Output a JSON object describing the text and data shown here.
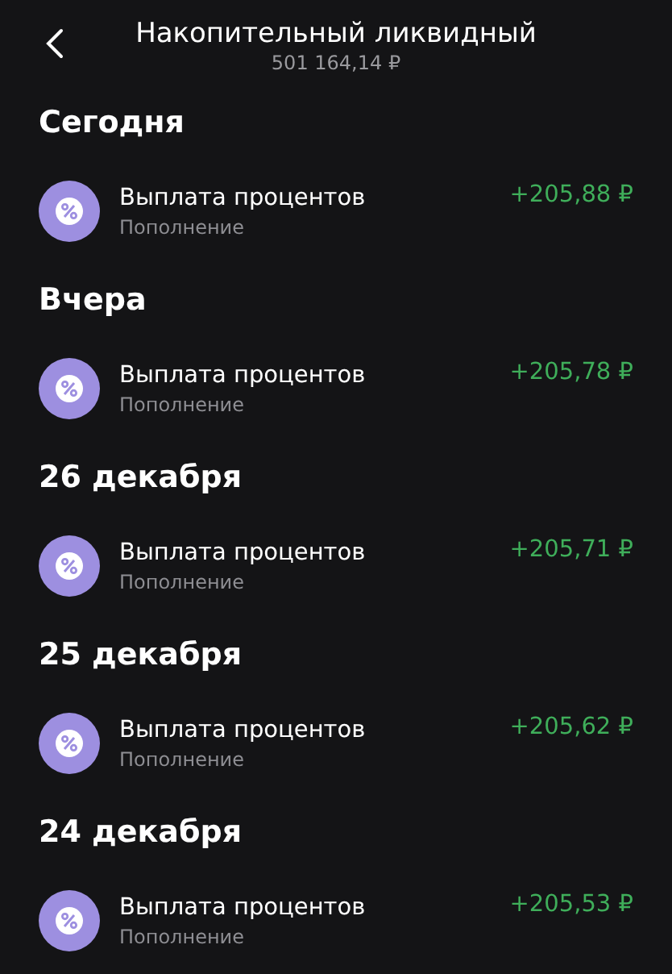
{
  "header": {
    "title": "Накопительный ликвидный",
    "balance": "501 164,14 ₽"
  },
  "days": [
    {
      "date": "Сегодня",
      "transactions": [
        {
          "title": "Выплата процентов",
          "subtitle": "Пополнение",
          "amount": "+205,88 ₽"
        }
      ]
    },
    {
      "date": "Вчера",
      "transactions": [
        {
          "title": "Выплата процентов",
          "subtitle": "Пополнение",
          "amount": "+205,78 ₽"
        }
      ]
    },
    {
      "date": "26 декабря",
      "transactions": [
        {
          "title": "Выплата процентов",
          "subtitle": "Пополнение",
          "amount": "+205,71 ₽"
        }
      ]
    },
    {
      "date": "25 декабря",
      "transactions": [
        {
          "title": "Выплата процентов",
          "subtitle": "Пополнение",
          "amount": "+205,62 ₽"
        }
      ]
    },
    {
      "date": "24 декабря",
      "transactions": [
        {
          "title": "Выплата процентов",
          "subtitle": "Пополнение",
          "amount": "+205,53 ₽"
        }
      ]
    }
  ]
}
